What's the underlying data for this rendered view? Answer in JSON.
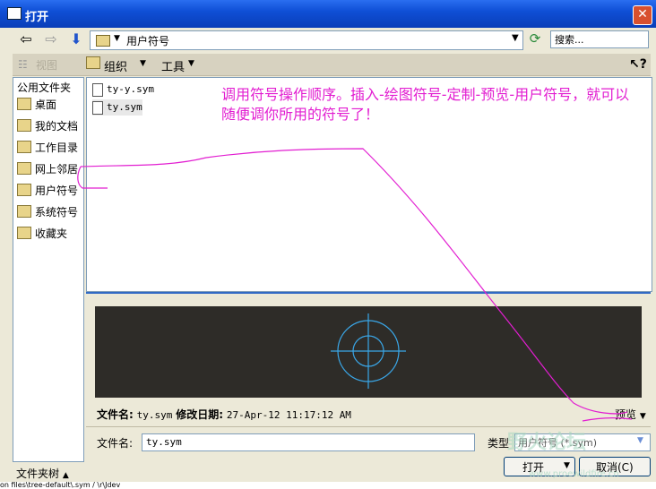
{
  "window": {
    "title": "打开"
  },
  "nav": {
    "path": "用户符号",
    "search_placeholder": "搜索..."
  },
  "toolbar": {
    "view_label": "视图",
    "organize_label": "组织",
    "tools_label": "工具"
  },
  "sidebar": {
    "title": "公用文件夹",
    "items": [
      {
        "label": "桌面",
        "icon": "desktop-icon"
      },
      {
        "label": "我的文档",
        "icon": "documents-icon"
      },
      {
        "label": "工作目录",
        "icon": "workdir-icon"
      },
      {
        "label": "网上邻居",
        "icon": "network-icon"
      },
      {
        "label": "用户符号",
        "icon": "folder-icon"
      },
      {
        "label": "系统符号",
        "icon": "folder-icon"
      },
      {
        "label": "收藏夹",
        "icon": "favorites-icon"
      }
    ]
  },
  "files": [
    {
      "name": "ty-y.sym"
    },
    {
      "name": "ty.sym"
    }
  ],
  "annotation": {
    "text": "调用符号操作顺序。插入-绘图符号-定制-预览-用户符号，就可以随便调你所用的符号了！",
    "color": "#e21ed1"
  },
  "info": {
    "file_label": "文件名:",
    "file_value": "ty.sym",
    "date_label": "修改日期:",
    "date_value": "27-Apr-12 11:17:12 AM",
    "preview_label": "预览"
  },
  "form": {
    "filename_label": "文件名:",
    "filename_value": "ty.sym",
    "type_label": "类型",
    "type_value": "用户符号 (*.sym)",
    "open_label": "打开",
    "cancel_label": "取消(C)"
  },
  "footer": {
    "folder_toggle": "文件夹树",
    "status": "on files\\tree-default\\.sym / \\r\\Jdev"
  },
  "watermark": {
    "text": "野火论坛",
    "url": "www.proewildfire.cn"
  },
  "colors": {
    "titlebar": "#0f4fd6",
    "annotation": "#e21ed1",
    "symbol": "#3aa7e8"
  }
}
